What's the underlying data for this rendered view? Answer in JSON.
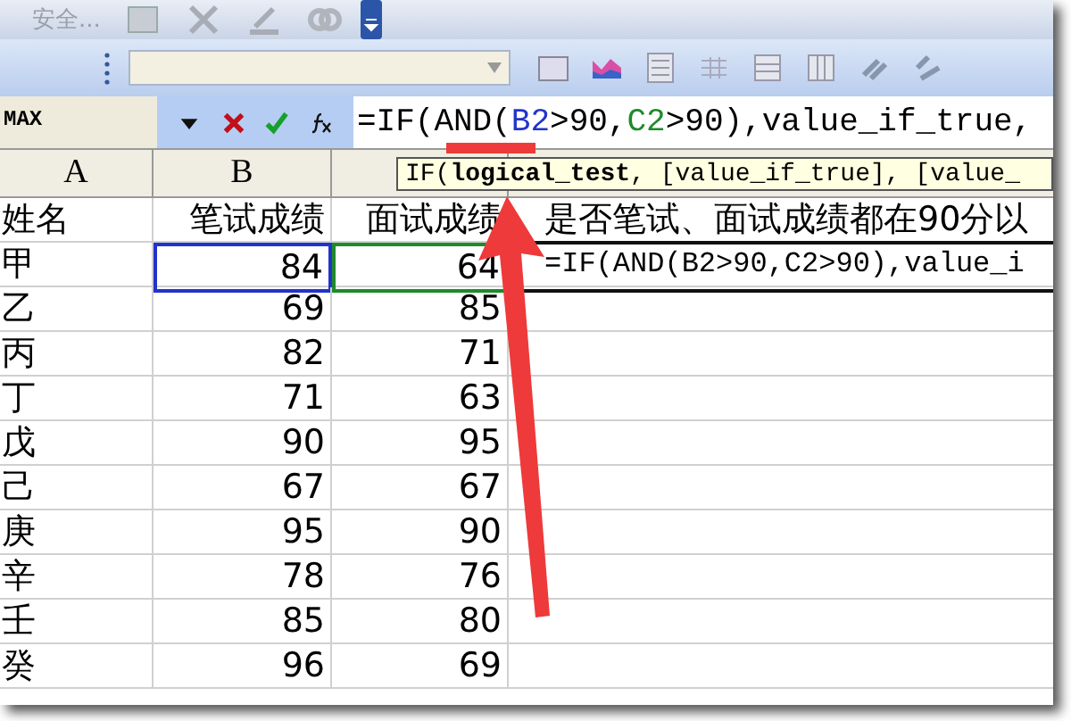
{
  "toolbar": {
    "label": "安全..."
  },
  "name_box": "MAX",
  "formula": [
    {
      "text": "=IF(AND(",
      "color": "#000000"
    },
    {
      "text": "B2",
      "color": "#2233cc"
    },
    {
      "text": ">90,",
      "color": "#000000"
    },
    {
      "text": "C2",
      "color": "#1e8a2a"
    },
    {
      "text": ">90),value_if_true,",
      "color": "#000000"
    }
  ],
  "tooltip": "IF(**logical_test**, [value_if_true], [value_",
  "columns": [
    "A",
    "B"
  ],
  "rows": [
    {
      "cells": [
        {
          "text": "姓名"
        },
        {
          "text": "笔试成绩"
        },
        {
          "text": "面试成绩"
        },
        {
          "text": "是否笔试、面试成绩都在90分以"
        }
      ]
    },
    {
      "cells": [
        {
          "text": "甲"
        },
        {
          "text": "84",
          "color": "#2233cc"
        },
        {
          "text": "64",
          "color": "#1e8a2a"
        },
        {
          "text": "=IF(AND(B2>90,C2>90),value_i"
        }
      ]
    },
    {
      "cells": [
        {
          "text": "乙"
        },
        {
          "text": "69"
        },
        {
          "text": "85"
        }
      ]
    },
    {
      "cells": [
        {
          "text": "丙"
        },
        {
          "text": "82"
        },
        {
          "text": "71"
        }
      ]
    },
    {
      "cells": [
        {
          "text": "丁"
        },
        {
          "text": "71"
        },
        {
          "text": "63"
        }
      ]
    },
    {
      "cells": [
        {
          "text": "戊"
        },
        {
          "text": "90"
        },
        {
          "text": "95"
        }
      ]
    },
    {
      "cells": [
        {
          "text": "己"
        },
        {
          "text": "67"
        },
        {
          "text": "67"
        }
      ]
    },
    {
      "cells": [
        {
          "text": "庚"
        },
        {
          "text": "95"
        },
        {
          "text": "90"
        }
      ]
    },
    {
      "cells": [
        {
          "text": "辛"
        },
        {
          "text": "78"
        },
        {
          "text": "76"
        }
      ]
    },
    {
      "cells": [
        {
          "text": "壬"
        },
        {
          "text": "85"
        },
        {
          "text": "80"
        }
      ]
    },
    {
      "cells": [
        {
          "text": "癸"
        },
        {
          "text": "96"
        },
        {
          "text": "69"
        }
      ]
    }
  ]
}
